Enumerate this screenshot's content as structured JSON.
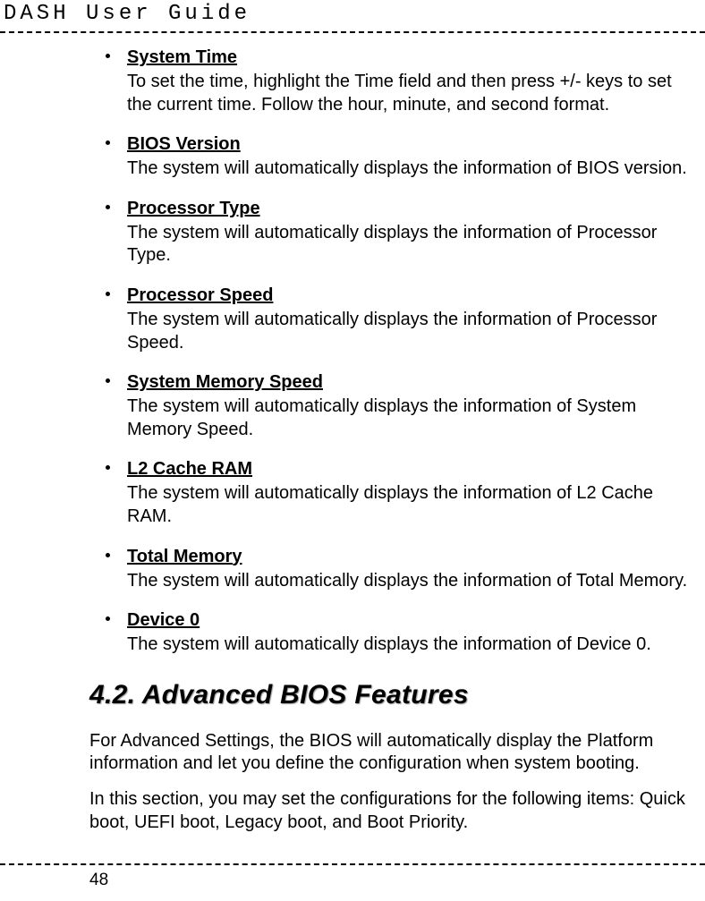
{
  "header": {
    "title": "DASH User Guide"
  },
  "items": [
    {
      "title": "System Time",
      "desc": "To set the time, highlight the Time field and then press +/- keys to set the current time. Follow the hour, minute, and second format."
    },
    {
      "title": "BIOS Version",
      "desc": "The system will automatically displays the information of BIOS version."
    },
    {
      "title": "Processor Type",
      "desc": "The system will automatically displays the information of Processor Type."
    },
    {
      "title": "Processor Speed",
      "desc": "The system will automatically displays the information of Processor Speed."
    },
    {
      "title": "System Memory Speed",
      "desc": "The system will automatically displays the information of System Memory Speed."
    },
    {
      "title": "L2 Cache RAM",
      "desc": "The system will automatically displays the information of L2 Cache RAM."
    },
    {
      "title": "Total Memory",
      "desc": "The system will automatically displays the information of Total Memory."
    },
    {
      "title": "Device 0",
      "desc": "The system will automatically displays the information of Device 0."
    }
  ],
  "section": {
    "heading": "4.2. Advanced BIOS Features",
    "para1": "For Advanced Settings, the BIOS will automatically display the Platform information and let you define the configuration when system booting.",
    "para2": "In this section, you may set the configurations for the following items: Quick boot, UEFI boot, Legacy boot, and Boot Priority."
  },
  "page_number": "48"
}
